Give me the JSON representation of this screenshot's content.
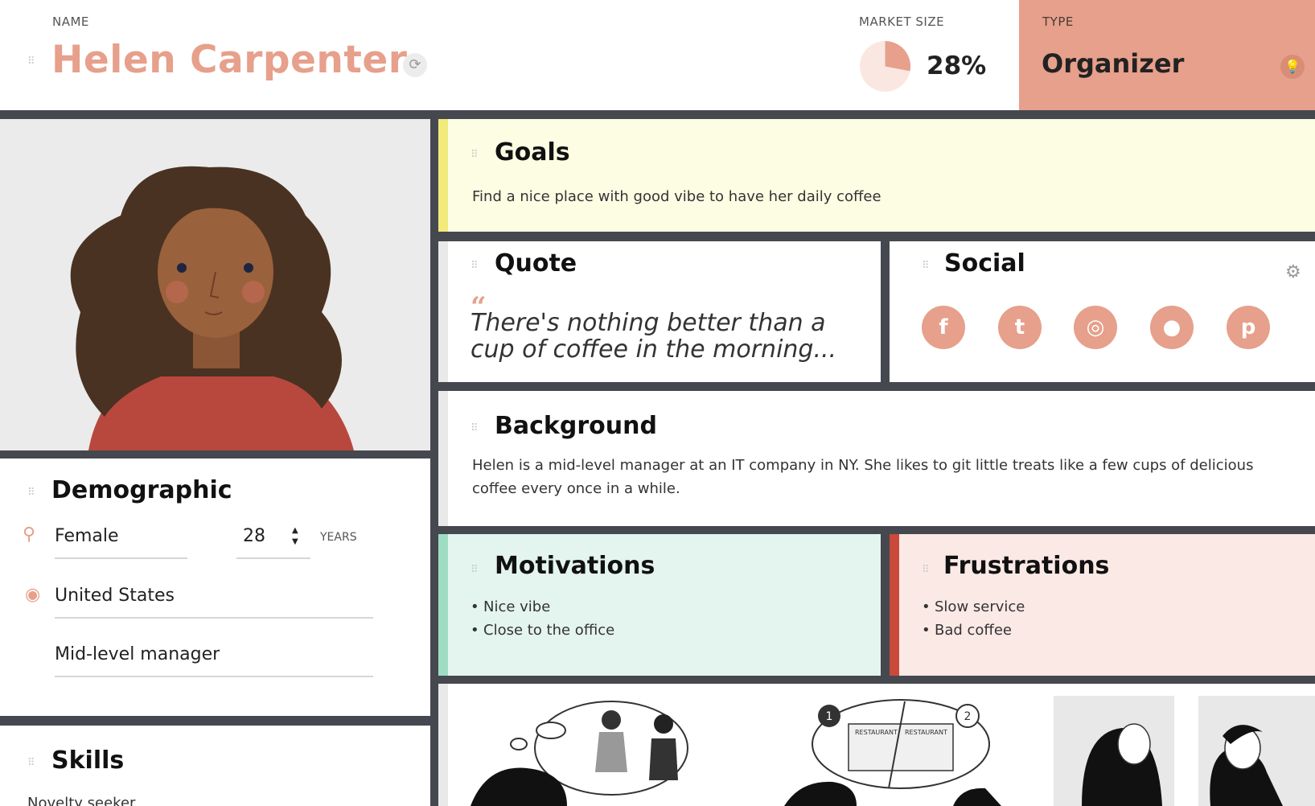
{
  "header": {
    "name_label": "NAME",
    "name": "Helen Carpenter",
    "market_size_label": "MARKET SIZE",
    "market_size_value": "28%",
    "market_size_fraction": 0.28,
    "type_label": "TYPE",
    "type_value": "Organizer"
  },
  "colors": {
    "accent": "#e6a08b",
    "divider": "#45484f",
    "goals_bg": "#fdfde4",
    "goals_accent": "#f2ea7a",
    "motivations_bg": "#e4f4ef",
    "motivations_accent": "#9fdcc4",
    "frustrations_bg": "#fbe9e6",
    "frustrations_accent": "#c9493b"
  },
  "demographic": {
    "title": "Demographic",
    "gender": "Female",
    "age": "28",
    "age_unit": "YEARS",
    "location": "United States",
    "occupation": "Mid-level manager"
  },
  "skills": {
    "title": "Skills",
    "first_item": "Novelty seeker"
  },
  "goals": {
    "title": "Goals",
    "text": "Find a nice place with good vibe to have her daily coffee"
  },
  "quote": {
    "title": "Quote",
    "mark": "“",
    "text": "There's nothing better than a cup of coffee in the morning..."
  },
  "social": {
    "title": "Social",
    "icons": [
      "facebook-icon",
      "twitter-icon",
      "instagram-icon",
      "location-pin-icon",
      "pinterest-icon"
    ],
    "glyphs": [
      "f",
      "t",
      "◎",
      "●",
      "p"
    ]
  },
  "background": {
    "title": "Background",
    "text": "Helen is a mid-level manager at an IT company in NY. She likes to git little treats like a few cups of delicious coffee every once in a while."
  },
  "motivations": {
    "title": "Motivations",
    "items": [
      "Nice vibe",
      "Close to the office"
    ]
  },
  "frustrations": {
    "title": "Frustrations",
    "items": [
      "Slow service",
      "Bad coffee"
    ]
  },
  "illustration": {
    "bubble_numbers": [
      "1",
      "2"
    ],
    "sign_texts": [
      "RESTAURANT",
      "RESTAURANT"
    ]
  }
}
